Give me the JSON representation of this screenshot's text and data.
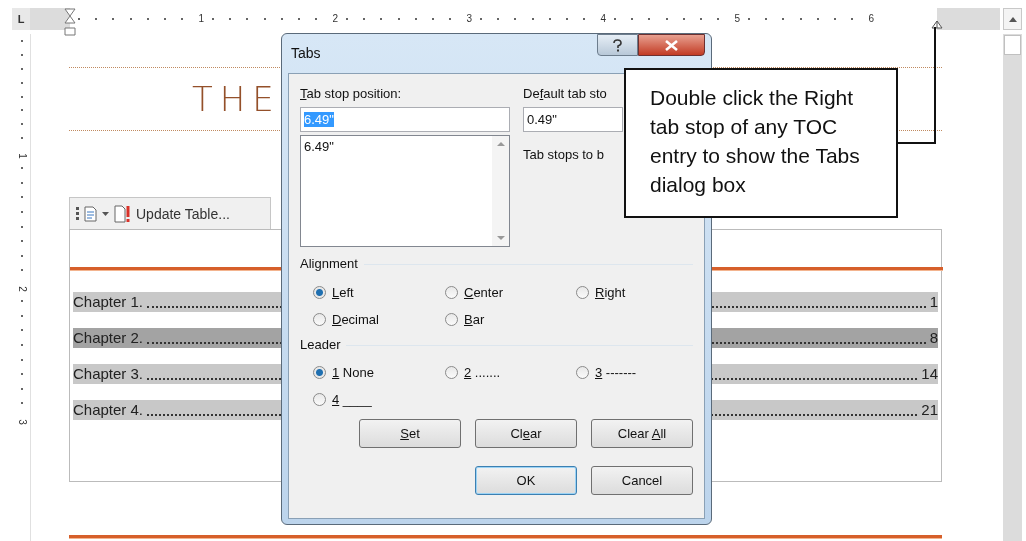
{
  "ruler": {
    "tab_selector": "L",
    "numbers": [
      "1",
      "2",
      "3",
      "4",
      "5",
      "6"
    ],
    "vertical_numbers": [
      "1",
      "2",
      "3"
    ]
  },
  "document": {
    "title": "THE",
    "toc_toolbar": {
      "update_button": "Update Table..."
    },
    "toc": [
      {
        "title": "Chapter 1.",
        "page": "1",
        "selected": false
      },
      {
        "title": "Chapter 2.",
        "page": "8",
        "selected": true
      },
      {
        "title": "Chapter 3.",
        "page": "14",
        "selected": false
      },
      {
        "title": "Chapter 4.",
        "page": "21",
        "selected": false
      }
    ]
  },
  "dialog": {
    "title": "Tabs",
    "tab_stop_position": {
      "label": {
        "key": "T",
        "rest": "ab stop position:"
      },
      "value": "6.49\"",
      "text_selected": true,
      "list": [
        "6.49\""
      ]
    },
    "default_tab_stops": {
      "label": {
        "pre": "De",
        "key": "f",
        "rest": "ault tab sto"
      },
      "value": "0.49\""
    },
    "clear_note": "Tab stops to b",
    "alignment": {
      "heading": "Alignment",
      "options": [
        {
          "label": {
            "key": "L",
            "rest": "eft"
          },
          "selected": true
        },
        {
          "label": {
            "key": "C",
            "rest": "enter"
          },
          "selected": false
        },
        {
          "label": {
            "key": "R",
            "rest": "ight"
          },
          "selected": false
        },
        {
          "label": {
            "key": "D",
            "rest": "ecimal"
          },
          "selected": false
        },
        {
          "label": {
            "key": "B",
            "rest": "ar"
          },
          "selected": false
        }
      ]
    },
    "leader": {
      "heading": "Leader",
      "options": [
        {
          "label": {
            "key": "1",
            "rest": " None"
          },
          "selected": true
        },
        {
          "label": {
            "key": "2",
            "rest": " ......."
          },
          "selected": false
        },
        {
          "label": {
            "key": "3",
            "rest": " -------"
          },
          "selected": false
        },
        {
          "label": {
            "key": "4",
            "rest": " ____"
          },
          "selected": false
        }
      ]
    },
    "action_buttons": [
      {
        "label": {
          "key": "S",
          "rest": "et"
        },
        "default": false
      },
      {
        "label": {
          "pre": "Cl",
          "key": "e",
          "rest": "ar"
        },
        "default": false
      },
      {
        "label": {
          "pre": "Clear ",
          "key": "A",
          "rest": "ll"
        },
        "default": false
      }
    ],
    "footer_buttons": [
      {
        "label": "OK",
        "default": true
      },
      {
        "label": "Cancel",
        "default": false
      }
    ]
  },
  "callout": {
    "text": "Double click the Right tab stop of any TOC entry to show the Tabs dialog box"
  }
}
